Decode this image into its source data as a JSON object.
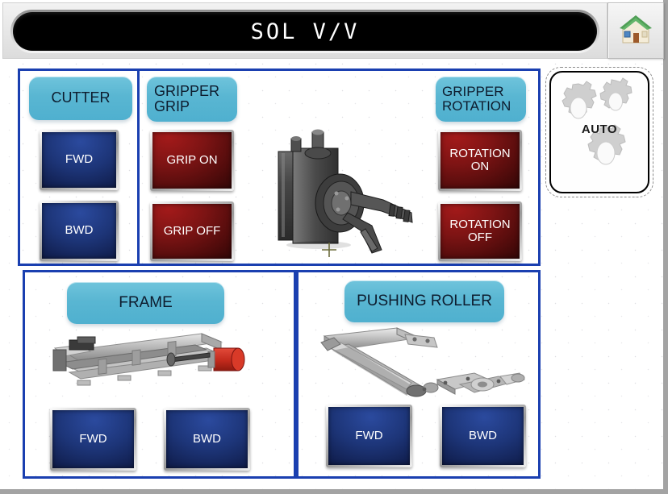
{
  "header": {
    "title": "SOL V/V",
    "home_icon": "home-icon"
  },
  "auto_button": {
    "label": "AUTO",
    "icon": "gears-icon"
  },
  "groups": [
    {
      "id": "cutter",
      "title": "CUTTER",
      "buttons": [
        {
          "label": "FWD",
          "color": "blue"
        },
        {
          "label": "BWD",
          "color": "blue"
        }
      ]
    },
    {
      "id": "gripper-grip",
      "title": "GRIPPER\nGRIP",
      "title_line1": "GRIPPER",
      "title_line2": "GRIP",
      "buttons": [
        {
          "label": "GRIP ON",
          "color": "red"
        },
        {
          "label": "GRIP OFF",
          "color": "red"
        }
      ]
    },
    {
      "id": "gripper-rotation",
      "title_line1": "GRIPPER",
      "title_line2": "ROTATION",
      "buttons": [
        {
          "label_line1": "ROTATION",
          "label_line2": "ON",
          "color": "red"
        },
        {
          "label_line1": "ROTATION",
          "label_line2": "OFF",
          "color": "red"
        }
      ]
    },
    {
      "id": "frame",
      "title": "FRAME",
      "buttons": [
        {
          "label": "FWD",
          "color": "blue"
        },
        {
          "label": "BWD",
          "color": "blue"
        }
      ],
      "image": "frame-machine-image"
    },
    {
      "id": "pushing-roller",
      "title": "PUSHING ROLLER",
      "buttons": [
        {
          "label": "FWD",
          "color": "blue"
        },
        {
          "label": "BWD",
          "color": "blue"
        }
      ],
      "image": "pushing-roller-machine-image"
    }
  ],
  "center_image": "gripper-cylinder-image",
  "colors": {
    "panel_border": "#1a3fb0",
    "header_cyan": "#59b6d2",
    "button_blue": "#1d3578",
    "button_red": "#7e1414",
    "title_bg": "#000000",
    "title_text": "#ffffff",
    "canvas_bg": "#ffffff",
    "frame_gray": "#a3a3a3"
  }
}
